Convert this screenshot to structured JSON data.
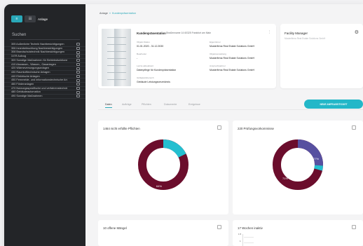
{
  "sidebar": {
    "top_buttons": [
      "≡",
      "☷"
    ],
    "title": "Anlage",
    "search_label": "Suchen",
    "items": [
      {
        "label": "305 Außenliche Technik Nachbesichtigungen"
      },
      {
        "label": "306 Innenbeleuchtung Nachbesichtigungen"
      },
      {
        "label": "308 Brandschutztechnik Nachbesichtigungen"
      },
      {
        "label": "3.ER Aufzug"
      },
      {
        "label": "309 Sonstige Maßnahmen für Betriebsfunktionen"
      },
      {
        "label": "410 Abwasser-, Wasser-, Gasanlagen"
      },
      {
        "label": "420 Wärmeversorgungsanlagen"
      },
      {
        "label": "430 Raumlufttechnische Anlagen"
      },
      {
        "label": "440 Elektrische Anlagen"
      },
      {
        "label": "450 Fernmelde- und informationstechnische Anlagen"
      },
      {
        "label": "460 Förderanlagen"
      },
      {
        "label": "470 Nutzungsspezifische und verfahrenstechnische Anlagen"
      },
      {
        "label": "480 Gebäudeautomation"
      },
      {
        "label": "490 Sonstige Maßnahmen"
      }
    ]
  },
  "breadcrumb": {
    "home": "Anlage",
    "current": "Kundenpräsentation"
  },
  "object": {
    "title": "Kundenpräsentation",
    "address": "Straßenname 14 60325 Frankfurt am Main",
    "more": "⋮",
    "fields": [
      {
        "label": "Objekt-Status",
        "value": "01.01.2020 - 31.12.2030"
      },
      {
        "label": "Eigentümer",
        "value": "Musterfirma Real Estate Solutions GmbH"
      },
      {
        "label": "Bearbeiter",
        "value": "-"
      },
      {
        "label": "Objektverwaltung",
        "value": "Musterfirma Real Estate Solutions GmbH"
      },
      {
        "label": "Letzte aktualisiert",
        "value": "Datenpflege für Kundenpräsentation"
      },
      {
        "label": "Ansprechpartner",
        "value": "Musterfirma Real Estate Solutions GmbH"
      },
      {
        "label": "Gültigkeitsbereich",
        "value": "Gebäude Leistungsverzeichnis"
      }
    ]
  },
  "facility_manager": {
    "title": "Facility Manager",
    "sub": "Musterfirma Real Estate Solutions GmbH"
  },
  "tabs": [
    "Daten",
    "Aufträge",
    "Pflichten",
    "Dokumente",
    "Ereignisse"
  ],
  "new_button": "NEUE ANFRAGE/TICKET",
  "cards": {
    "duties": {
      "title": "1464 nicht erfüllte Pflichten",
      "center_label": "64%",
      "top_label": "33%"
    },
    "inspections": {
      "title": "220 Prüfungsvorkommisse",
      "left_label": "71%",
      "right_label": "27%"
    },
    "defects": {
      "title": "10 offene Mängel"
    },
    "weeks": {
      "title": "17 Wochen inaktiv",
      "axis_labels": [
        "1.5",
        "1"
      ]
    }
  },
  "chart_data": [
    {
      "type": "pie",
      "title": "1464 nicht erfüllte Pflichten",
      "values": [
        64,
        33,
        3
      ],
      "labels": [
        "64%",
        "33%",
        ""
      ],
      "colors": [
        "#6b0d2c",
        "#24bfd0",
        "#cfd7dc"
      ]
    },
    {
      "type": "pie",
      "title": "220 Prüfungsvorkommisse",
      "values": [
        71,
        27,
        2
      ],
      "labels": [
        "71%",
        "27%",
        ""
      ],
      "colors": [
        "#6b0d2c",
        "#5750a0",
        "#24bfd0"
      ]
    }
  ]
}
